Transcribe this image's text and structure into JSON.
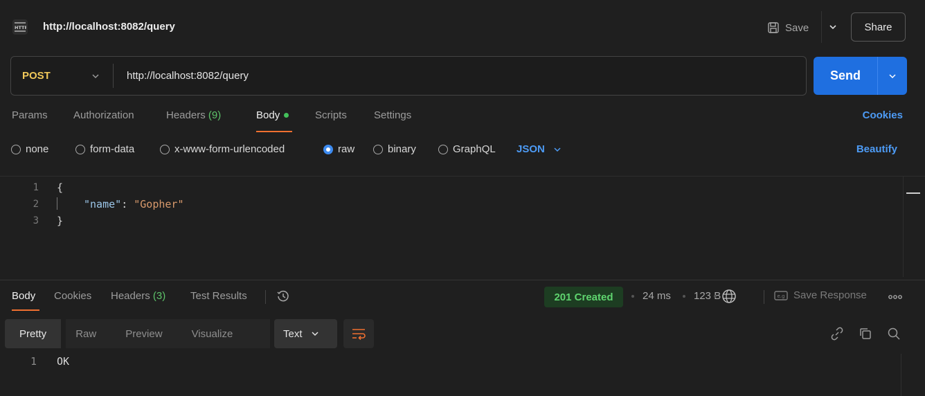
{
  "titlebar": {
    "badge_icon": "http-icon",
    "title": "http://localhost:8082/query",
    "save_label": "Save",
    "share_label": "Share"
  },
  "request": {
    "method": "POST",
    "url": "http://localhost:8082/query",
    "send_label": "Send"
  },
  "request_tabs": {
    "params": "Params",
    "authorization": "Authorization",
    "headers": "Headers",
    "headers_count": "(9)",
    "body": "Body",
    "scripts": "Scripts",
    "settings": "Settings",
    "cookies": "Cookies",
    "active": "Body"
  },
  "body_options": {
    "none": "none",
    "form_data": "form-data",
    "urlencoded": "x-www-form-urlencoded",
    "raw": "raw",
    "binary": "binary",
    "graphql": "GraphQL",
    "selected": "raw",
    "format": "JSON",
    "beautify": "Beautify"
  },
  "editor": {
    "line_numbers": [
      "1",
      "2",
      "3"
    ],
    "open_brace": "{",
    "key": "\"name\"",
    "colon": ": ",
    "value": "\"Gopher\"",
    "close_brace": "}"
  },
  "response_tabs": {
    "body": "Body",
    "cookies": "Cookies",
    "headers": "Headers",
    "headers_count": "(3)",
    "test_results": "Test Results",
    "active": "Body"
  },
  "response_meta": {
    "status": "201 Created",
    "time": "24 ms",
    "size": "123 B",
    "save_response": "Save Response",
    "status_color": "#5fd46f"
  },
  "response_view": {
    "pretty": "Pretty",
    "raw": "Raw",
    "preview": "Preview",
    "visualize": "Visualize",
    "format": "Text",
    "active": "Pretty"
  },
  "response_body": {
    "line_number": "1",
    "text": "OK"
  },
  "colors": {
    "accent": "#1f6fe0",
    "method": "#f0c85a",
    "link": "#4d9bf5",
    "tab_underline": "#f07030"
  }
}
